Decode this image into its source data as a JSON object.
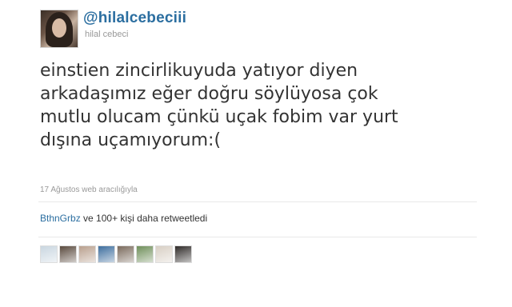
{
  "user": {
    "handle": "@hilalcebeciii",
    "display_name": "hilal cebeci"
  },
  "tweet": {
    "lines": [
      "einstien zincirlikuyuda yatıyor diyen",
      "arkadaşımız eğer doğru söylüyosa çok",
      "mutlu olucam çünkü uçak fobim var yurt",
      "dışına uçamıyorum:("
    ],
    "meta": "17 Ağustos web aracılığıyla"
  },
  "retweets": {
    "user_link": "BthnGrbz",
    "suffix": " ve 100+ kişi daha retweetledi",
    "avatar_colors": [
      "#c9d6e0",
      "#5a4a3e",
      "#b9a08e",
      "#3d6e9e",
      "#7a6a5c",
      "#6f8f5a",
      "#d8cfc4",
      "#2e2a28"
    ]
  },
  "colors": {
    "link": "#2b6ea0",
    "text": "#333333",
    "muted": "#999999"
  }
}
